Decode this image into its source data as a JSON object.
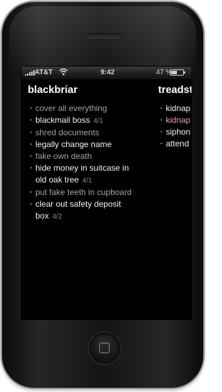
{
  "status_bar": {
    "carrier": "AT&T",
    "time": "9:42",
    "battery_percent": "47 %",
    "battery_level": 0.47,
    "icons": [
      "signal-icon",
      "wifi-icon",
      "battery-icon"
    ]
  },
  "lists": [
    {
      "title": "blackbriar",
      "tasks": [
        {
          "lines": [
            "cover all everything"
          ],
          "due": "",
          "style": "dim"
        },
        {
          "lines": [
            "blackmail boss"
          ],
          "due": "4/1",
          "style": "bright"
        },
        {
          "lines": [
            "shred documents"
          ],
          "due": "",
          "style": "dim"
        },
        {
          "lines": [
            "legally change name"
          ],
          "due": "",
          "style": "bright"
        },
        {
          "lines": [
            "fake own death"
          ],
          "due": "",
          "style": "dim"
        },
        {
          "lines": [
            "hide money in suitcase in",
            "old oak tree"
          ],
          "due": "4/1",
          "style": "bright"
        },
        {
          "lines": [
            "put fake teeth in cupboard"
          ],
          "due": "",
          "style": "dim"
        },
        {
          "lines": [
            "clear out safety deposit",
            "box"
          ],
          "due": "4/2",
          "style": "bright"
        }
      ]
    },
    {
      "title": "treadst",
      "tasks": [
        {
          "lines": [
            "kidnap"
          ],
          "due": "",
          "style": "bright"
        },
        {
          "lines": [
            "kidnap"
          ],
          "due": "",
          "style": "pink"
        },
        {
          "lines": [
            "siphon"
          ],
          "due": "",
          "style": "bright"
        },
        {
          "lines": [
            "attend a"
          ],
          "due": "",
          "style": "bright"
        }
      ]
    }
  ],
  "colors": {
    "screen_background": "#000000",
    "text_bright": "#f2f2f2",
    "text_dim": "#a3a3a3",
    "text_pink": "#e6a3ad",
    "bullet": "#777777"
  }
}
